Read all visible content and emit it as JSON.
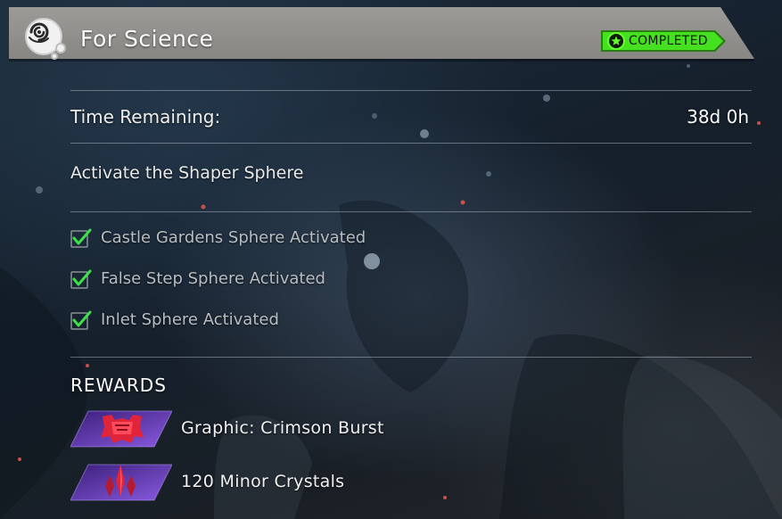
{
  "quest": {
    "title": "For Science",
    "emblem_icon": "galaxy-swirl-icon",
    "status": {
      "label": "COMPLETED",
      "icon": "star-badge-icon",
      "color": "#3cd21e"
    }
  },
  "time": {
    "label": "Time Remaining:",
    "value": "38d 0h"
  },
  "objective": {
    "text": "Activate the Shaper Sphere"
  },
  "tasks": [
    {
      "label": "Castle Gardens Sphere Activated",
      "done": true
    },
    {
      "label": "False Step Sphere Activated",
      "done": true
    },
    {
      "label": "Inlet Sphere Activated",
      "done": true
    }
  ],
  "rewards": {
    "heading": "REWARDS",
    "items": [
      {
        "label": "Graphic: Crimson Burst",
        "icon": "crimson-burst-emblem-icon"
      },
      {
        "label": "120 Minor Crystals",
        "icon": "crystal-cluster-icon"
      }
    ]
  },
  "colors": {
    "header_bg": "#cfcdc8",
    "check_green": "#3ee04a",
    "reward_purple": "#6b3fc4",
    "reward_red": "#e0243a"
  }
}
